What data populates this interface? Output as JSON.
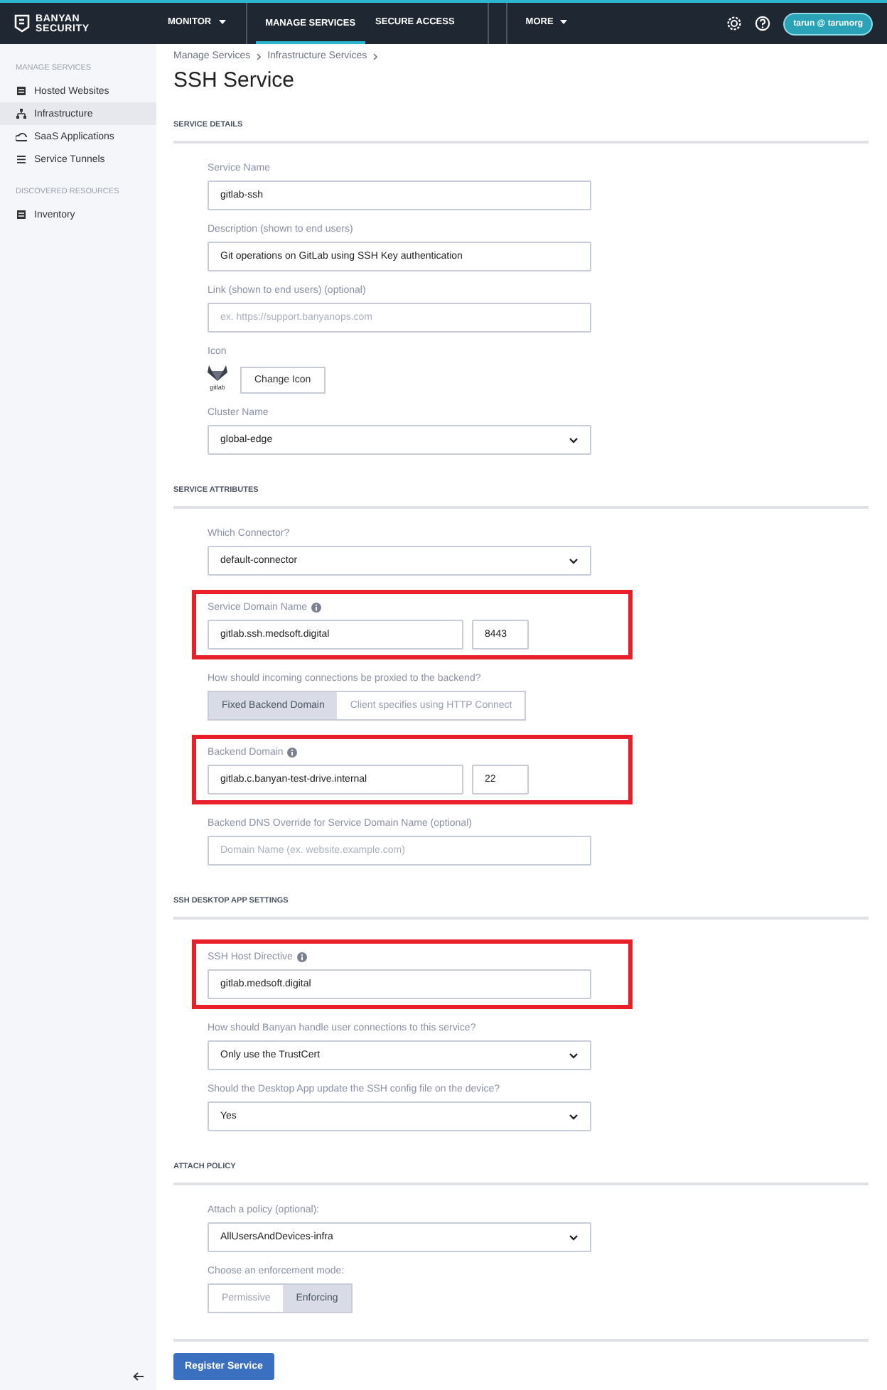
{
  "topbar": {
    "logo": [
      "BANYAN",
      "SECURITY"
    ],
    "nav": [
      {
        "label": "MONITOR",
        "dropdown": true,
        "selected": false
      },
      {
        "label": "MANAGE SERVICES",
        "dropdown": false,
        "selected": true
      },
      {
        "label": "SECURE ACCESS",
        "dropdown": false,
        "selected": false
      },
      {
        "label": "MORE",
        "dropdown": true,
        "selected": false
      }
    ],
    "user": "tarun @ tarunorg"
  },
  "sidebar": {
    "groups": [
      {
        "heading": "MANAGE SERVICES",
        "items": [
          {
            "label": "Hosted Websites",
            "kind": "server",
            "selected": false
          },
          {
            "label": "Infrastructure",
            "kind": "network",
            "selected": true
          },
          {
            "label": "SaaS Applications",
            "kind": "cloud",
            "selected": false
          },
          {
            "label": "Service Tunnels",
            "kind": "list",
            "selected": false
          }
        ]
      },
      {
        "heading": "DISCOVERED RESOURCES",
        "items": [
          {
            "label": "Inventory",
            "kind": "server",
            "selected": false
          }
        ]
      }
    ]
  },
  "breadcrumb": [
    "Manage Services",
    "Infrastructure Services"
  ],
  "title": "SSH Service",
  "sections": [
    {
      "heading": "SERVICE DETAILS",
      "fields": [
        {
          "kind": "text",
          "label": "Service Name",
          "value": "gitlab-ssh"
        },
        {
          "kind": "text",
          "label": "Description (shown to end users)",
          "value": "Git operations on GitLab using SSH Key authentication"
        },
        {
          "kind": "text",
          "label": "Link (shown to end users) (optional)",
          "placeholder": "ex. https://support.banyanops.com"
        },
        {
          "kind": "icon",
          "label": "Icon",
          "caption": "gitlab",
          "button": "Change Icon"
        },
        {
          "kind": "select",
          "label": "Cluster Name",
          "value": "global-edge"
        }
      ]
    },
    {
      "heading": "SERVICE ATTRIBUTES",
      "fields": [
        {
          "kind": "select",
          "label": "Which Connector?",
          "value": "default-connector"
        },
        {
          "kind": "hostport",
          "label": "Service Domain Name",
          "info": true,
          "highlighted": true,
          "value": "gitlab.ssh.medsoft.digital",
          "port": "8443"
        },
        {
          "kind": "segmented",
          "label": "How should incoming connections be proxied to the backend?",
          "options": [
            {
              "label": "Fixed Backend Domain",
              "selected": true
            },
            {
              "label": "Client specifies using HTTP Connect",
              "selected": false
            }
          ]
        },
        {
          "kind": "hostport",
          "label": "Backend Domain",
          "info": true,
          "highlighted": true,
          "value": "gitlab.c.banyan-test-drive.internal",
          "port": "22"
        },
        {
          "kind": "text",
          "label": "Backend DNS Override for Service Domain Name (optional)",
          "placeholder": "Domain Name (ex. website.example.com)"
        }
      ]
    },
    {
      "heading": "SSH DESKTOP APP SETTINGS",
      "fields": [
        {
          "kind": "text",
          "label": "SSH Host Directive",
          "info": true,
          "highlighted": true,
          "value": "gitlab.medsoft.digital"
        },
        {
          "kind": "select",
          "label": "How should Banyan handle user connections to this service?",
          "value": "Only use the TrustCert"
        },
        {
          "kind": "select",
          "label": "Should the Desktop App update the SSH config file on the device?",
          "value": "Yes"
        }
      ]
    },
    {
      "heading": "ATTACH POLICY",
      "fields": [
        {
          "kind": "select",
          "label": "Attach a policy (optional):",
          "value": "AllUsersAndDevices-infra"
        },
        {
          "kind": "segmented",
          "label": "Choose an enforcement mode:",
          "options": [
            {
              "label": "Permissive",
              "selected": false
            },
            {
              "label": "Enforcing",
              "selected": true
            }
          ]
        }
      ]
    }
  ],
  "submit": "Register Service"
}
